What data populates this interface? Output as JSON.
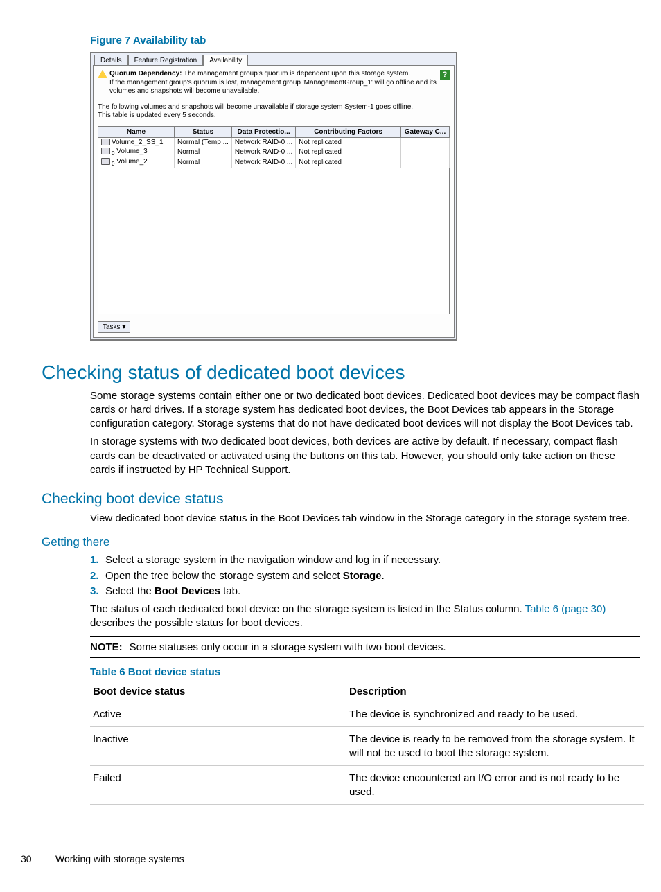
{
  "figure": {
    "caption": "Figure 7 Availability tab",
    "tabs": [
      "Details",
      "Feature Registration",
      "Availability"
    ],
    "active_tab": "Availability",
    "warning_label": "Quorum Dependency:",
    "warning_line1": " The management group's quorum is dependent upon this storage system.",
    "warning_line2": "If the management group's quorum is lost, management group 'ManagementGroup_1' will go offline and its volumes and snapshots will become unavailable.",
    "note_line1": "The following volumes and snapshots will become unavailable if storage system System-1 goes offline.",
    "note_line2": "This table is updated every 5 seconds.",
    "help_symbol": "?",
    "columns": [
      "Name",
      "Status",
      "Data Protectio...",
      "Contributing Factors",
      "Gateway C..."
    ],
    "rows": [
      {
        "name": "Volume_2_SS_1",
        "status": "Normal (Temp ...",
        "dp": "Network RAID-0 ...",
        "cf": "Not replicated",
        "gw": ""
      },
      {
        "name": "Volume_3",
        "status": "Normal",
        "dp": "Network RAID-0 ...",
        "cf": "Not replicated",
        "gw": ""
      },
      {
        "name": "Volume_2",
        "status": "Normal",
        "dp": "Network RAID-0 ...",
        "cf": "Not replicated",
        "gw": ""
      }
    ],
    "tasks_label": "Tasks ▾"
  },
  "sections": {
    "h1": "Checking status of dedicated boot devices",
    "p1": "Some storage systems contain either one or two dedicated boot devices. Dedicated boot devices may be compact flash cards or hard drives. If a storage system has dedicated boot devices, the Boot Devices tab appears in the Storage configuration category. Storage systems that do not have dedicated boot devices will not display the Boot Devices tab.",
    "p2": "In storage systems with two dedicated boot devices, both devices are active by default. If necessary, compact flash cards can be deactivated or activated using the buttons on this tab. However, you should only take action on these cards if instructed by HP Technical Support.",
    "h2": "Checking boot device status",
    "p3": "View dedicated boot device status in the Boot Devices tab window in the Storage category in the storage system tree.",
    "h3": "Getting there",
    "steps": [
      {
        "n": "1.",
        "text_pre": "Select a storage system in the navigation window and log in if necessary.",
        "bold": "",
        "text_post": ""
      },
      {
        "n": "2.",
        "text_pre": "Open the tree below the storage system and select ",
        "bold": "Storage",
        "text_post": "."
      },
      {
        "n": "3.",
        "text_pre": "Select the ",
        "bold": "Boot Devices",
        "text_post": " tab."
      }
    ],
    "p4_a": "The status of each dedicated boot device on the storage system is listed in the Status column. ",
    "p4_link": "Table 6 (page 30)",
    "p4_b": " describes the possible status for boot devices.",
    "note_label": "NOTE:",
    "note_text": "Some statuses only occur in a storage system with two boot devices.",
    "table_caption": "Table 6 Boot device status",
    "table_headers": [
      "Boot device status",
      "Description"
    ],
    "table_rows": [
      {
        "s": "Active",
        "d": "The device is synchronized and ready to be used."
      },
      {
        "s": "Inactive",
        "d": "The device is ready to be removed from the storage system. It will not be used to boot the storage system."
      },
      {
        "s": "Failed",
        "d": "The device encountered an I/O error and is not ready to be used."
      }
    ]
  },
  "footer": {
    "page": "30",
    "title": "Working with storage systems"
  }
}
